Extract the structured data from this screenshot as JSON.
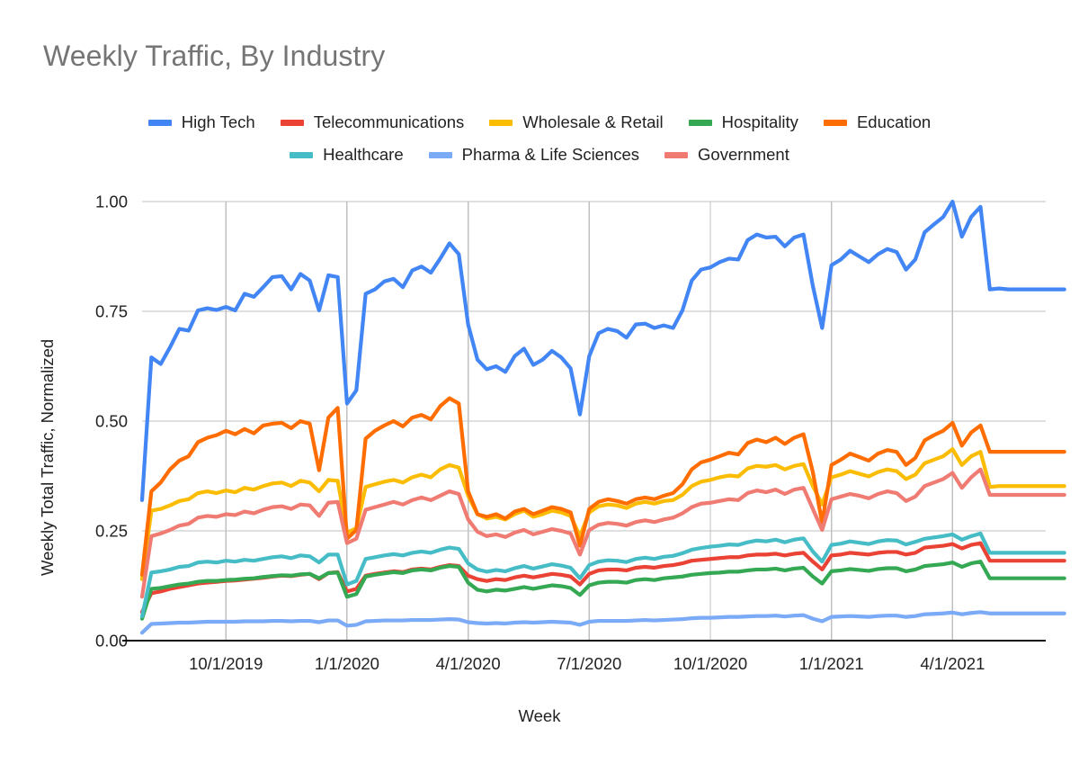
{
  "chart_data": {
    "type": "line",
    "title": "Weekly Traffic, By Industry",
    "xlabel": "Week",
    "ylabel": "Weekly Total Traffic, Normalized",
    "ylim": [
      0.0,
      1.0
    ],
    "yticks": [
      "0.00",
      "0.25",
      "0.50",
      "0.75",
      "1.00"
    ],
    "ytick_values": [
      0.0,
      0.25,
      0.5,
      0.75,
      1.0
    ],
    "xticks": [
      "10/1/2019",
      "1/1/2020",
      "4/1/2020",
      "7/1/2020",
      "10/1/2020",
      "1/1/2021",
      "4/1/2021"
    ],
    "xtick_positions": [
      9,
      22,
      35,
      48,
      61,
      74,
      87
    ],
    "x_count": 98,
    "grid": true,
    "legend_position": "top",
    "series": [
      {
        "name": "High Tech",
        "color": "#4285F4",
        "values": [
          0.32,
          0.645,
          0.63,
          0.668,
          0.71,
          0.706,
          0.752,
          0.757,
          0.753,
          0.76,
          0.752,
          0.79,
          0.783,
          0.805,
          0.828,
          0.83,
          0.8,
          0.835,
          0.82,
          0.752,
          0.832,
          0.828,
          0.54,
          0.57,
          0.79,
          0.8,
          0.818,
          0.824,
          0.805,
          0.843,
          0.852,
          0.838,
          0.87,
          0.905,
          0.88,
          0.72,
          0.64,
          0.618,
          0.625,
          0.612,
          0.648,
          0.665,
          0.628,
          0.64,
          0.66,
          0.645,
          0.62,
          0.515,
          0.648,
          0.7,
          0.71,
          0.705,
          0.69,
          0.72,
          0.722,
          0.712,
          0.718,
          0.712,
          0.752,
          0.82,
          0.845,
          0.85,
          0.862,
          0.87,
          0.868,
          0.912,
          0.925,
          0.918,
          0.92,
          0.898,
          0.918,
          0.925,
          0.808,
          0.712,
          0.855,
          0.868,
          0.888,
          0.875,
          0.862,
          0.88,
          0.892,
          0.885,
          0.845,
          0.868,
          0.93,
          0.948,
          0.965,
          1.0,
          0.92,
          0.965,
          0.988,
          0.8,
          0.802,
          0.8,
          0.8,
          0.8,
          0.8,
          0.8,
          0.8,
          0.8
        ]
      },
      {
        "name": "Telecommunications",
        "color": "#EA4335",
        "values": [
          0.065,
          0.108,
          0.112,
          0.118,
          0.122,
          0.126,
          0.13,
          0.132,
          0.134,
          0.136,
          0.137,
          0.139,
          0.141,
          0.143,
          0.146,
          0.148,
          0.147,
          0.15,
          0.152,
          0.14,
          0.154,
          0.156,
          0.112,
          0.118,
          0.148,
          0.152,
          0.155,
          0.158,
          0.156,
          0.162,
          0.164,
          0.162,
          0.168,
          0.172,
          0.17,
          0.148,
          0.14,
          0.136,
          0.14,
          0.138,
          0.144,
          0.148,
          0.144,
          0.148,
          0.152,
          0.15,
          0.146,
          0.128,
          0.152,
          0.16,
          0.162,
          0.162,
          0.16,
          0.166,
          0.168,
          0.166,
          0.17,
          0.172,
          0.176,
          0.182,
          0.184,
          0.186,
          0.188,
          0.19,
          0.19,
          0.194,
          0.196,
          0.196,
          0.198,
          0.194,
          0.198,
          0.2,
          0.18,
          0.162,
          0.194,
          0.196,
          0.2,
          0.198,
          0.196,
          0.2,
          0.202,
          0.202,
          0.196,
          0.2,
          0.212,
          0.214,
          0.216,
          0.22,
          0.21,
          0.218,
          0.222,
          0.182,
          0.182,
          0.182,
          0.182,
          0.182,
          0.182,
          0.182,
          0.182,
          0.182
        ]
      },
      {
        "name": "Wholesale & Retail",
        "color": "#FBBC04",
        "values": [
          0.14,
          0.296,
          0.3,
          0.308,
          0.318,
          0.322,
          0.336,
          0.34,
          0.336,
          0.342,
          0.338,
          0.348,
          0.344,
          0.352,
          0.358,
          0.36,
          0.352,
          0.364,
          0.36,
          0.34,
          0.366,
          0.364,
          0.246,
          0.256,
          0.35,
          0.356,
          0.362,
          0.366,
          0.36,
          0.372,
          0.378,
          0.372,
          0.39,
          0.4,
          0.394,
          0.33,
          0.288,
          0.278,
          0.282,
          0.276,
          0.288,
          0.296,
          0.282,
          0.288,
          0.296,
          0.292,
          0.284,
          0.238,
          0.292,
          0.306,
          0.31,
          0.308,
          0.302,
          0.312,
          0.316,
          0.312,
          0.318,
          0.32,
          0.332,
          0.352,
          0.362,
          0.366,
          0.372,
          0.376,
          0.374,
          0.392,
          0.398,
          0.396,
          0.4,
          0.39,
          0.398,
          0.402,
          0.352,
          0.31,
          0.372,
          0.378,
          0.386,
          0.38,
          0.374,
          0.384,
          0.39,
          0.386,
          0.368,
          0.378,
          0.404,
          0.412,
          0.42,
          0.436,
          0.4,
          0.42,
          0.43,
          0.35,
          0.352,
          0.352,
          0.352,
          0.352,
          0.352,
          0.352,
          0.352,
          0.352
        ]
      },
      {
        "name": "Hospitality",
        "color": "#34A853",
        "values": [
          0.05,
          0.118,
          0.12,
          0.124,
          0.128,
          0.13,
          0.134,
          0.136,
          0.136,
          0.138,
          0.139,
          0.141,
          0.142,
          0.145,
          0.147,
          0.149,
          0.148,
          0.151,
          0.152,
          0.142,
          0.154,
          0.155,
          0.1,
          0.106,
          0.146,
          0.15,
          0.153,
          0.156,
          0.154,
          0.16,
          0.162,
          0.16,
          0.166,
          0.17,
          0.168,
          0.132,
          0.116,
          0.112,
          0.116,
          0.114,
          0.118,
          0.122,
          0.118,
          0.122,
          0.126,
          0.124,
          0.12,
          0.104,
          0.126,
          0.132,
          0.134,
          0.134,
          0.132,
          0.138,
          0.14,
          0.138,
          0.142,
          0.144,
          0.146,
          0.15,
          0.152,
          0.154,
          0.155,
          0.157,
          0.157,
          0.16,
          0.162,
          0.162,
          0.164,
          0.16,
          0.164,
          0.166,
          0.146,
          0.13,
          0.158,
          0.16,
          0.163,
          0.161,
          0.159,
          0.163,
          0.165,
          0.165,
          0.158,
          0.162,
          0.17,
          0.172,
          0.174,
          0.178,
          0.168,
          0.176,
          0.18,
          0.142,
          0.142,
          0.142,
          0.142,
          0.142,
          0.142,
          0.142,
          0.142,
          0.142
        ]
      },
      {
        "name": "Education",
        "color": "#FF6D01",
        "values": [
          0.15,
          0.34,
          0.36,
          0.39,
          0.41,
          0.42,
          0.452,
          0.462,
          0.468,
          0.478,
          0.47,
          0.482,
          0.472,
          0.49,
          0.494,
          0.496,
          0.484,
          0.5,
          0.494,
          0.388,
          0.508,
          0.53,
          0.232,
          0.252,
          0.46,
          0.478,
          0.49,
          0.5,
          0.488,
          0.508,
          0.514,
          0.504,
          0.534,
          0.552,
          0.54,
          0.34,
          0.288,
          0.282,
          0.288,
          0.278,
          0.294,
          0.3,
          0.288,
          0.296,
          0.304,
          0.3,
          0.292,
          0.216,
          0.3,
          0.316,
          0.322,
          0.318,
          0.312,
          0.322,
          0.326,
          0.322,
          0.33,
          0.336,
          0.356,
          0.39,
          0.406,
          0.412,
          0.42,
          0.428,
          0.424,
          0.45,
          0.458,
          0.452,
          0.462,
          0.448,
          0.462,
          0.47,
          0.384,
          0.268,
          0.4,
          0.412,
          0.426,
          0.418,
          0.41,
          0.426,
          0.434,
          0.43,
          0.4,
          0.416,
          0.456,
          0.468,
          0.478,
          0.496,
          0.444,
          0.474,
          0.49,
          0.43,
          0.43,
          0.43,
          0.43,
          0.43,
          0.43,
          0.43,
          0.43,
          0.43
        ]
      },
      {
        "name": "Healthcare",
        "color": "#46BDC6",
        "values": [
          0.055,
          0.155,
          0.158,
          0.162,
          0.168,
          0.17,
          0.178,
          0.18,
          0.178,
          0.182,
          0.18,
          0.184,
          0.182,
          0.186,
          0.19,
          0.192,
          0.188,
          0.194,
          0.192,
          0.178,
          0.196,
          0.196,
          0.128,
          0.136,
          0.186,
          0.19,
          0.194,
          0.197,
          0.194,
          0.2,
          0.203,
          0.2,
          0.207,
          0.212,
          0.209,
          0.176,
          0.162,
          0.157,
          0.161,
          0.158,
          0.165,
          0.17,
          0.164,
          0.169,
          0.174,
          0.171,
          0.166,
          0.142,
          0.172,
          0.18,
          0.183,
          0.182,
          0.179,
          0.186,
          0.189,
          0.186,
          0.191,
          0.193,
          0.199,
          0.207,
          0.211,
          0.214,
          0.216,
          0.219,
          0.218,
          0.224,
          0.228,
          0.226,
          0.23,
          0.224,
          0.23,
          0.233,
          0.203,
          0.18,
          0.218,
          0.221,
          0.226,
          0.223,
          0.22,
          0.226,
          0.229,
          0.228,
          0.219,
          0.225,
          0.232,
          0.235,
          0.238,
          0.242,
          0.23,
          0.238,
          0.244,
          0.2,
          0.2,
          0.2,
          0.2,
          0.2,
          0.2,
          0.2,
          0.2,
          0.2
        ]
      },
      {
        "name": "Pharma & Life Sciences",
        "color": "#7BAAF7",
        "values": [
          0.018,
          0.038,
          0.039,
          0.04,
          0.041,
          0.041,
          0.042,
          0.043,
          0.043,
          0.043,
          0.043,
          0.044,
          0.044,
          0.044,
          0.045,
          0.045,
          0.044,
          0.045,
          0.045,
          0.042,
          0.046,
          0.046,
          0.034,
          0.036,
          0.044,
          0.045,
          0.046,
          0.046,
          0.046,
          0.047,
          0.047,
          0.047,
          0.048,
          0.049,
          0.048,
          0.042,
          0.04,
          0.039,
          0.04,
          0.039,
          0.041,
          0.042,
          0.041,
          0.042,
          0.043,
          0.042,
          0.041,
          0.036,
          0.043,
          0.045,
          0.045,
          0.045,
          0.045,
          0.046,
          0.047,
          0.046,
          0.047,
          0.048,
          0.049,
          0.051,
          0.052,
          0.052,
          0.053,
          0.054,
          0.054,
          0.055,
          0.056,
          0.056,
          0.057,
          0.055,
          0.057,
          0.058,
          0.05,
          0.044,
          0.054,
          0.055,
          0.056,
          0.055,
          0.054,
          0.056,
          0.057,
          0.057,
          0.054,
          0.056,
          0.06,
          0.061,
          0.062,
          0.064,
          0.06,
          0.063,
          0.065,
          0.062,
          0.062,
          0.062,
          0.062,
          0.062,
          0.062,
          0.062,
          0.062,
          0.062
        ]
      },
      {
        "name": "Government",
        "color": "#F07B72",
        "values": [
          0.1,
          0.238,
          0.244,
          0.252,
          0.262,
          0.266,
          0.28,
          0.284,
          0.282,
          0.288,
          0.286,
          0.294,
          0.29,
          0.298,
          0.304,
          0.306,
          0.3,
          0.31,
          0.308,
          0.284,
          0.314,
          0.316,
          0.222,
          0.232,
          0.298,
          0.304,
          0.31,
          0.316,
          0.31,
          0.32,
          0.326,
          0.32,
          0.33,
          0.34,
          0.334,
          0.276,
          0.248,
          0.238,
          0.242,
          0.236,
          0.246,
          0.252,
          0.242,
          0.248,
          0.254,
          0.25,
          0.244,
          0.196,
          0.252,
          0.264,
          0.268,
          0.266,
          0.262,
          0.27,
          0.274,
          0.27,
          0.276,
          0.28,
          0.29,
          0.304,
          0.312,
          0.314,
          0.318,
          0.322,
          0.32,
          0.336,
          0.342,
          0.338,
          0.344,
          0.334,
          0.344,
          0.348,
          0.3,
          0.252,
          0.322,
          0.328,
          0.334,
          0.33,
          0.324,
          0.334,
          0.34,
          0.336,
          0.318,
          0.328,
          0.352,
          0.36,
          0.368,
          0.382,
          0.348,
          0.372,
          0.39,
          0.332,
          0.332,
          0.332,
          0.332,
          0.332,
          0.332,
          0.332,
          0.332,
          0.332
        ]
      }
    ]
  },
  "legend": {
    "row1": [
      {
        "label": "High Tech",
        "color": "#4285F4"
      },
      {
        "label": "Telecommunications",
        "color": "#EA4335"
      },
      {
        "label": "Wholesale & Retail",
        "color": "#FBBC04"
      },
      {
        "label": "Hospitality",
        "color": "#34A853"
      },
      {
        "label": "Education",
        "color": "#FF6D01"
      }
    ],
    "row2": [
      {
        "label": "Healthcare",
        "color": "#46BDC6"
      },
      {
        "label": "Pharma & Life Sciences",
        "color": "#7BAAF7"
      },
      {
        "label": "Government",
        "color": "#F07B72"
      }
    ]
  },
  "colors": {
    "title": "#757575",
    "text": "#222222",
    "gridline": "#c0c0c0",
    "axis": "#111111",
    "background": "#ffffff"
  }
}
